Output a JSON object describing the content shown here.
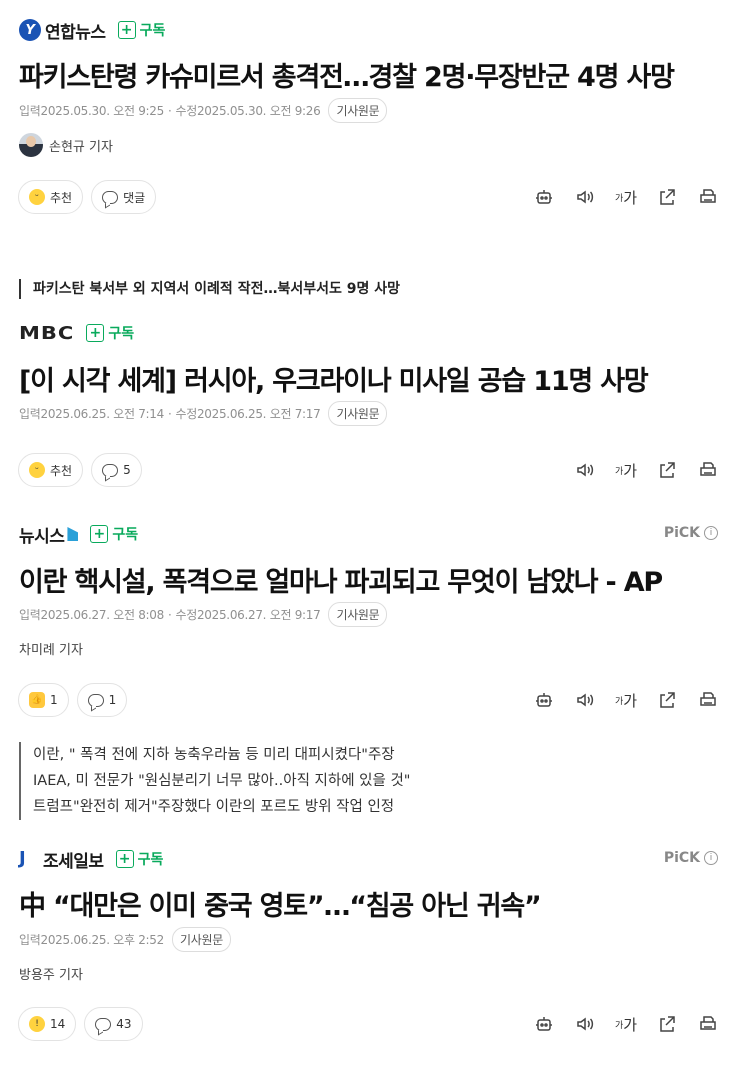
{
  "articles": [
    {
      "press": "연합뉴스",
      "subscribe": "구독",
      "headline": "파키스탄령 카슈미르서 총격전…경찰 2명·무장반군 4명 사망",
      "input_label": "입력",
      "input_time": "2025.05.30. 오전 9:25",
      "edit_label": "수정",
      "edit_time": "2025.05.30. 오전 9:26",
      "original": "기사원문",
      "reporter": "손현규 기자",
      "like_label": "추천",
      "comment_label": "댓글"
    },
    {
      "summary": "파키스탄 북서부 외 지역서 이례적 작전…북서부서도 9명 사망",
      "press": "MBC",
      "subscribe": "구독",
      "headline": "[이 시각 세계] 러시아, 우크라이나 미사일 공습 11명 사망",
      "input_label": "입력",
      "input_time": "2025.06.25. 오전 7:14",
      "edit_label": "수정",
      "edit_time": "2025.06.25. 오전 7:17",
      "original": "기사원문",
      "like_label": "추천",
      "comment_count": "5"
    },
    {
      "press": "뉴시스",
      "subscribe": "구독",
      "pick": "PiCK",
      "headline": "이란 핵시설, 폭격으로 얼마나 파괴되고 무엇이 남았나 - AP",
      "input_label": "입력",
      "input_time": "2025.06.27. 오전 8:08",
      "edit_label": "수정",
      "edit_time": "2025.06.27. 오전 9:17",
      "original": "기사원문",
      "reporter": "차미례 기자",
      "like_count": "1",
      "comment_count": "1",
      "summary_lines": [
        "이란, \" 폭격 전에 지하 농축우라늄 등 미리 대피시켰다\"주장",
        "IAEA, 미 전문가 \"원심분리기 너무 많아..아직 지하에 있을 것\"",
        "트럼프\"완전히 제거\"주장했다 이란의 포르도 방위 작업 인정"
      ]
    },
    {
      "press": "조세일보",
      "subscribe": "구독",
      "pick": "PiCK",
      "headline": "中 “대만은 이미 중국 영토”…“침공 아닌 귀속”",
      "input_label": "입력",
      "input_time": "2025.06.25. 오후 2:52",
      "original": "기사원문",
      "reporter": "방용주 기자",
      "like_count": "14",
      "comment_count": "43"
    }
  ],
  "tools": {
    "font_small": "가",
    "font_large": "가",
    "icons": [
      "robot-icon",
      "speaker-icon",
      "font-size-icon",
      "share-icon",
      "print-icon"
    ]
  },
  "colors": {
    "subscribe_green": "#09aa5c",
    "yonhap_blue": "#1a53b4",
    "meta_gray": "#909090"
  }
}
